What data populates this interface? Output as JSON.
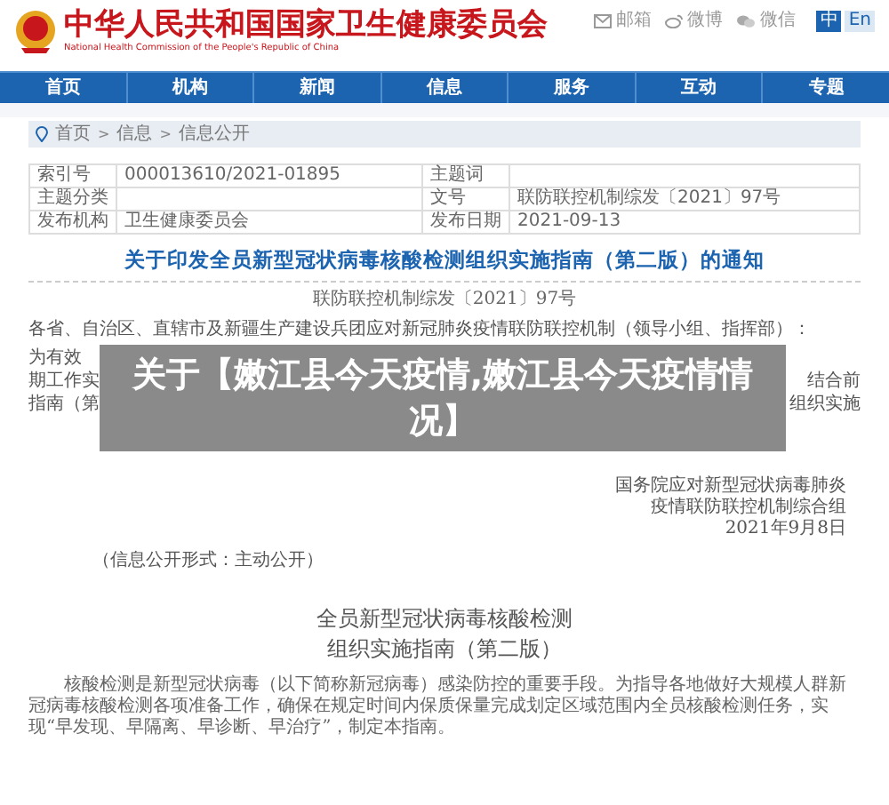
{
  "header": {
    "title": "中华人民共和国国家卫生健康委员会",
    "subtitle": "National Health Commission of the People's Republic of China",
    "links": [
      {
        "kind": "mail",
        "label": "邮箱"
      },
      {
        "kind": "weibo",
        "label": "微博"
      },
      {
        "kind": "wechat",
        "label": "微信"
      }
    ],
    "languages": [
      {
        "label": "中",
        "selected": true
      },
      {
        "label": "En",
        "selected": false
      }
    ]
  },
  "nav": [
    "首页",
    "机构",
    "新闻",
    "信息",
    "服务",
    "互动",
    "专题"
  ],
  "breadcrumb": [
    {
      "label": "首页"
    },
    {
      "separator": ">",
      "label": "信息"
    },
    {
      "separator": ">",
      "label": "信息公开"
    }
  ],
  "meta_table": [
    {
      "label_1": "索引号",
      "value_1": "000013610/2021-01895",
      "label_2": "主题词"
    },
    {
      "label_1": "主题分类",
      "label_2": "文号",
      "value_2": "联防联控机制综发〔2021〕97号"
    },
    {
      "label_1": "发布机构",
      "value_1": "卫生健康委员会",
      "label_2": "发布日期",
      "value_2": "2021-09-13"
    }
  ],
  "article": {
    "title": "关于印发全员新型冠状病毒核酸检测组织实施指南（第二版）的通知",
    "doc_number": "联防联控机制综发〔2021〕97号",
    "paragraphs": [
      "各省、自治区、直辖市及新疆生产建设兵团应对新冠肺炎疫情联防联控机制（领导小组、指挥部）："
    ],
    "covered_lines_left": [
      "为有效",
      "期工作实",
      "指南（第"
    ],
    "covered_lines_right": [
      "结合前",
      "组织实施"
    ],
    "signature": [
      "国务院应对新型冠状病毒肺炎",
      "疫情联防联控机制综合组",
      "2021年9月8日"
    ],
    "disclosure": "（信息公开形式：主动公开）",
    "guide_title": [
      "全员新型冠状病毒核酸检测",
      "组织实施指南（第二版）"
    ],
    "guide_paragraph": "核酸检测是新型冠状病毒（以下简称新冠病毒）感染防控的重要手段。为指导各地做好大规模人群新冠病毒核酸检测各项准备工作，确保在规定时间内保质保量完成划定区域范围内全员核酸检测任务，实现“早发现、早隔离、早诊断、早治疗”，制定本指南。"
  },
  "overlay_caption": "关于【嫩江县今天疫情,嫩江县今天疫情情况】"
}
